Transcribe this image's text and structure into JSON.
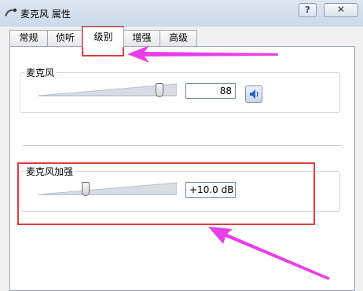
{
  "window": {
    "title": "麦克风 属性",
    "help_label": "?",
    "close_label": "✕"
  },
  "tabs": [
    {
      "label": "常规"
    },
    {
      "label": "侦听"
    },
    {
      "label": "级别",
      "active": true
    },
    {
      "label": "增强"
    },
    {
      "label": "高级"
    }
  ],
  "microphone": {
    "label": "麦克风",
    "level": 88,
    "level_text": "88",
    "mute_icon": "speaker-icon"
  },
  "boost": {
    "label": "麦克风加强",
    "value_text": "+10.0 dB",
    "level_fraction": 0.33
  },
  "colors": {
    "annotation_red": "#e33b3b",
    "annotation_arrow": "#e83ee8",
    "tab_border": "#9aa5b6"
  }
}
